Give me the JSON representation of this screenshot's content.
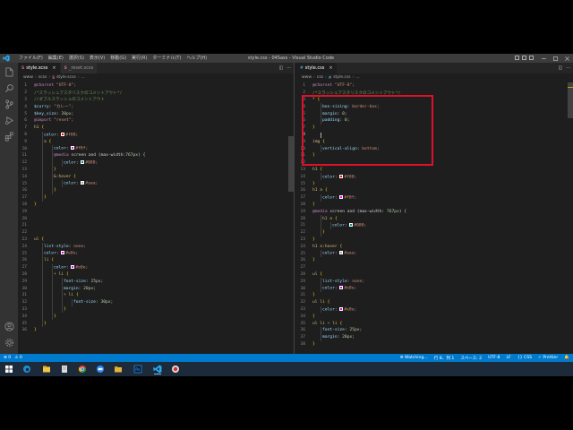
{
  "titlebar": {
    "menu": [
      "ファイル(F)",
      "編集(E)",
      "選択(S)",
      "表示(V)",
      "移動(G)",
      "実行(R)",
      "ターミナル(T)",
      "ヘルプ(H)"
    ],
    "title": "style.css - 04Sass - Visual Studio Code"
  },
  "left_group": {
    "tabs": [
      {
        "icon": "S",
        "label": "style.scss"
      },
      {
        "icon": "S",
        "label": "_reset.scss"
      }
    ],
    "breadcrumb": [
      "www",
      "scss",
      "style.scss",
      "..."
    ]
  },
  "right_group": {
    "tabs": [
      {
        "icon": "#",
        "label": "style.css"
      }
    ],
    "breadcrumb": [
      "www",
      "css",
      "style.css",
      "..."
    ]
  },
  "colors": {
    "red": "#ff0000",
    "purple": "#ff00ff",
    "teal": "#008888",
    "gray": "#aaaaaa",
    "pink": "#ee00ee",
    "accent": "#007acc",
    "highlight": "#e0102a"
  },
  "left_code": [
    {
      "n": "1",
      "t": "@charset \"UTF-8\";"
    },
    {
      "n": "2",
      "t": "/*スラッシュアスタリスクのコメントアウト*/"
    },
    {
      "n": "3",
      "t": "//ダブルスラッシュのコメントアウト"
    },
    {
      "n": "4",
      "t": "$curry: \"カレー\";"
    },
    {
      "n": "5",
      "t": "$key_size: 20px;"
    },
    {
      "n": "6",
      "t": "@import \"reset\";"
    },
    {
      "n": "7",
      "t": "h1 {"
    },
    {
      "n": "8",
      "t": "color: #f00;"
    },
    {
      "n": "9",
      "t": "a {"
    },
    {
      "n": "10",
      "t": "color: #f0f;"
    },
    {
      "n": "11",
      "t": "@media screen and (max-width:767px) {"
    },
    {
      "n": "12",
      "t": "color: #088;"
    },
    {
      "n": "13",
      "t": "}"
    },
    {
      "n": "14",
      "t": "&:hover {"
    },
    {
      "n": "15",
      "t": "color: #aaa;"
    },
    {
      "n": "16",
      "t": "}"
    },
    {
      "n": "17",
      "t": "}"
    },
    {
      "n": "18",
      "t": "}"
    },
    {
      "n": "19",
      "t": ""
    },
    {
      "n": "20",
      "t": ""
    },
    {
      "n": "21",
      "t": ""
    },
    {
      "n": "22",
      "t": ""
    },
    {
      "n": "23",
      "t": "ul {"
    },
    {
      "n": "24",
      "t": "list-style: none;"
    },
    {
      "n": "25",
      "t": "color: #e0e;"
    },
    {
      "n": "26",
      "t": "li {"
    },
    {
      "n": "27",
      "t": "color: #e0e;"
    },
    {
      "n": "28",
      "t": "+ li {"
    },
    {
      "n": "29",
      "t": "font-size: 25px;"
    },
    {
      "n": "30",
      "t": "margin: 20px;"
    },
    {
      "n": "31",
      "t": "+ li {"
    },
    {
      "n": "32",
      "t": "font-size: 30px;"
    },
    {
      "n": "33",
      "t": "}"
    },
    {
      "n": "34",
      "t": "}"
    },
    {
      "n": "35",
      "t": "}"
    },
    {
      "n": "36",
      "t": "}"
    }
  ],
  "right_code": [
    {
      "n": "1",
      "t": "@charset \"UTF-8\";"
    },
    {
      "n": "2",
      "t": "/*スラッシュアスタリスクのコメントアウト*/"
    },
    {
      "n": "3",
      "t": "* {"
    },
    {
      "n": "4",
      "t": "box-sizing: border-box;"
    },
    {
      "n": "5",
      "t": "margin: 0;"
    },
    {
      "n": "6",
      "t": "padding: 0;"
    },
    {
      "n": "7",
      "t": "}"
    },
    {
      "n": "8",
      "t": ""
    },
    {
      "n": "9",
      "t": "img {"
    },
    {
      "n": "10",
      "t": "vertical-align: bottom;"
    },
    {
      "n": "11",
      "t": "}"
    },
    {
      "n": "12",
      "t": ""
    },
    {
      "n": "13",
      "t": "h1 {"
    },
    {
      "n": "14",
      "t": "color: #f00;"
    },
    {
      "n": "15",
      "t": "}"
    },
    {
      "n": "16",
      "t": "h1 a {"
    },
    {
      "n": "17",
      "t": "color: #f0f;"
    },
    {
      "n": "18",
      "t": "}"
    },
    {
      "n": "19",
      "t": "@media screen and (max-width: 767px) {"
    },
    {
      "n": "20",
      "t": "h1 a {"
    },
    {
      "n": "21",
      "t": "color: #088;"
    },
    {
      "n": "22",
      "t": "}"
    },
    {
      "n": "23",
      "t": "}"
    },
    {
      "n": "24",
      "t": "h1 a:hover {"
    },
    {
      "n": "25",
      "t": "color: #aaa;"
    },
    {
      "n": "26",
      "t": "}"
    },
    {
      "n": "27",
      "t": ""
    },
    {
      "n": "28",
      "t": "ul {"
    },
    {
      "n": "29",
      "t": "list-style: none;"
    },
    {
      "n": "30",
      "t": "color: #e0e;"
    },
    {
      "n": "31",
      "t": "}"
    },
    {
      "n": "32",
      "t": "ul li {"
    },
    {
      "n": "33",
      "t": "color: #e0e;"
    },
    {
      "n": "34",
      "t": "}"
    },
    {
      "n": "35",
      "t": "ul li + li {"
    },
    {
      "n": "36",
      "t": "font-size: 25px;"
    },
    {
      "n": "37",
      "t": "margin: 20px;"
    },
    {
      "n": "38",
      "t": "}"
    }
  ],
  "statusbar": {
    "errors": "⊗ 0",
    "warnings": "⚠ 0",
    "watching": "⊚ Watching...",
    "position": "行 8、列 1",
    "spaces": "スペース: 2",
    "encoding": "UTF-8",
    "eol": "LF",
    "language": "{} CSS",
    "prettier": "✓ Prettier"
  }
}
